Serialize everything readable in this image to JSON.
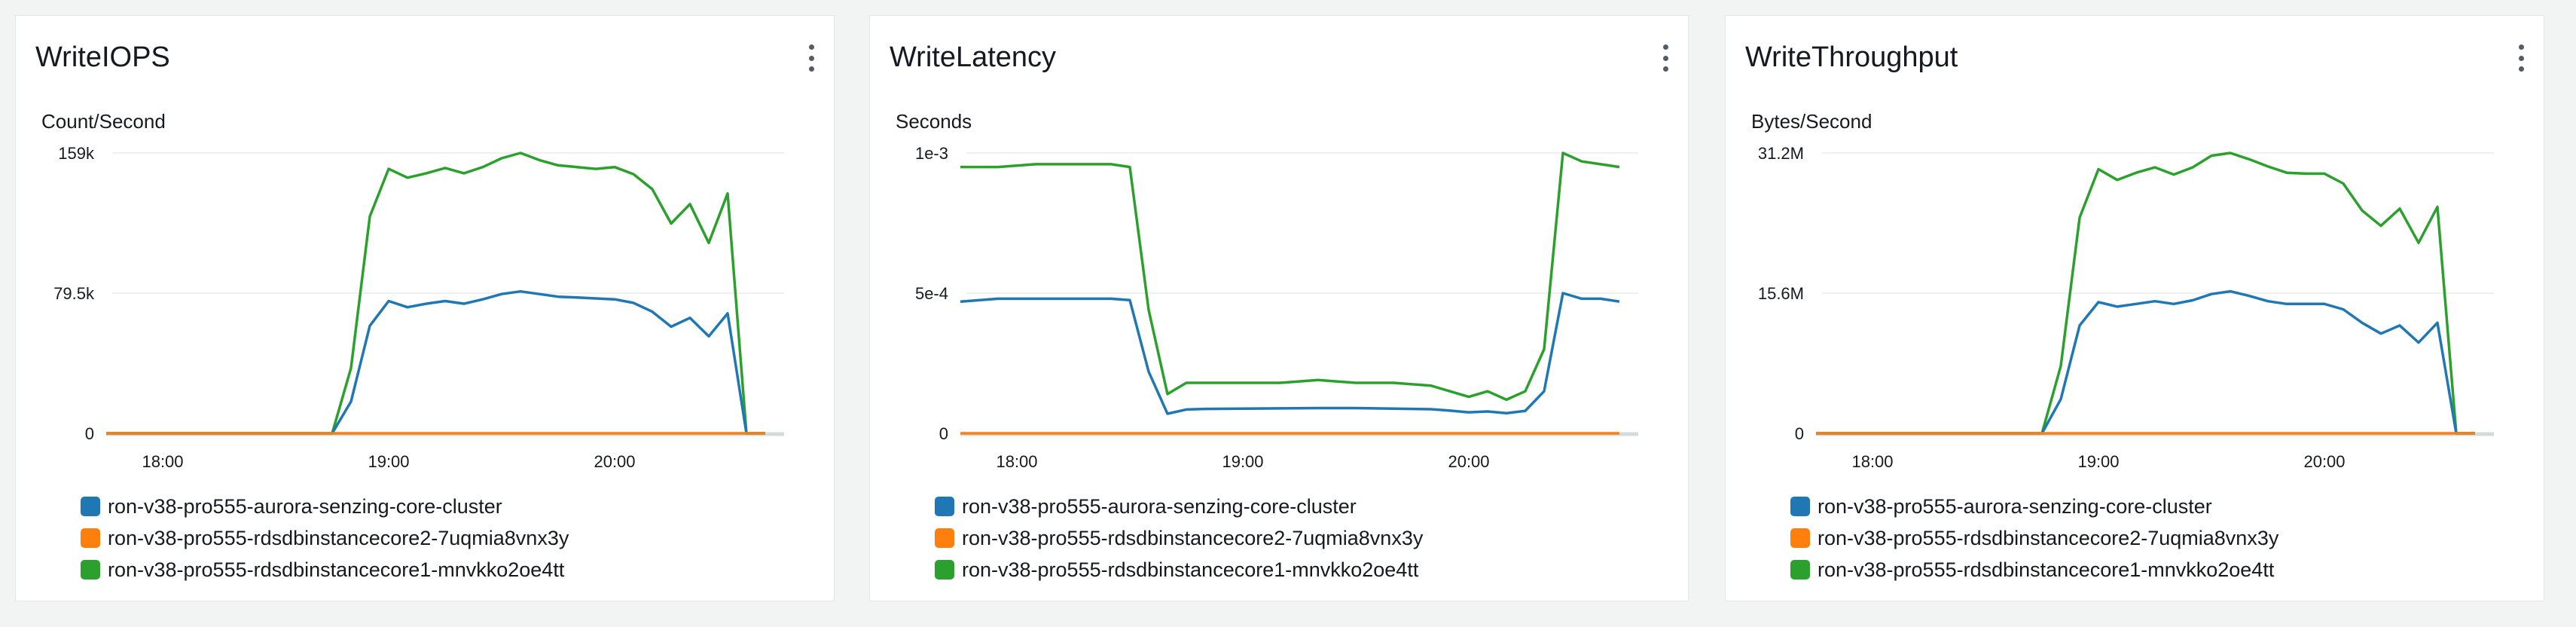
{
  "colors": {
    "blue": "#1f77b4",
    "orange": "#ff7f0e",
    "green": "#2ca02c",
    "grid": "#e9ebed",
    "axis": "#d5dbdb"
  },
  "legend": [
    "ron-v38-pro555-aurora-senzing-core-cluster",
    "ron-v38-pro555-rdsdbinstancecore2-7uqmia8vnx3y",
    "ron-v38-pro555-rdsdbinstancecore1-mnvkko2oe4tt"
  ],
  "widgets": [
    {
      "title": "WriteIOPS",
      "menu_icon": "vertical-ellipsis-icon"
    },
    {
      "title": "WriteLatency",
      "menu_icon": "vertical-ellipsis-icon"
    },
    {
      "title": "WriteThroughput",
      "menu_icon": "vertical-ellipsis-icon"
    }
  ],
  "chart_data": [
    {
      "type": "line",
      "title": "WriteIOPS",
      "ylabel": "Count/Second",
      "ylim": [
        0,
        159000
      ],
      "ytick_values": [
        0,
        79500,
        159000
      ],
      "ytick_labels": [
        "0",
        "79.5k",
        "159k"
      ],
      "xlim": [
        "17:45",
        "20:45"
      ],
      "xticks": [
        "18:00",
        "19:00",
        "20:00"
      ],
      "x": [
        "17:45",
        "17:50",
        "17:55",
        "18:00",
        "18:05",
        "18:10",
        "18:15",
        "18:20",
        "18:25",
        "18:30",
        "18:35",
        "18:40",
        "18:45",
        "18:50",
        "18:55",
        "19:00",
        "19:05",
        "19:10",
        "19:15",
        "19:20",
        "19:25",
        "19:30",
        "19:35",
        "19:40",
        "19:45",
        "19:50",
        "19:55",
        "20:00",
        "20:05",
        "20:10",
        "20:15",
        "20:20",
        "20:25",
        "20:30",
        "20:35",
        "20:40"
      ],
      "series": [
        {
          "name": "ron-v38-pro555-aurora-senzing-core-cluster",
          "color": "#1f77b4",
          "values": [
            0,
            0,
            0,
            0,
            0,
            0,
            0,
            0,
            0,
            0,
            0,
            0,
            0,
            18000,
            61000,
            75000,
            71500,
            73500,
            75000,
            73500,
            76000,
            79000,
            80500,
            79000,
            77500,
            77000,
            76500,
            76000,
            74000,
            69000,
            60500,
            65500,
            55000,
            68000,
            0,
            0
          ]
        },
        {
          "name": "ron-v38-pro555-rdsdbinstancecore2-7uqmia8vnx3y",
          "color": "#ff7f0e",
          "values": [
            0,
            0,
            0,
            0,
            0,
            0,
            0,
            0,
            0,
            0,
            0,
            0,
            0,
            0,
            0,
            0,
            0,
            0,
            0,
            0,
            0,
            0,
            0,
            0,
            0,
            0,
            0,
            0,
            0,
            0,
            0,
            0,
            0,
            0,
            0,
            0
          ]
        },
        {
          "name": "ron-v38-pro555-rdsdbinstancecore1-mnvkko2oe4tt",
          "color": "#2ca02c",
          "values": [
            0,
            0,
            0,
            0,
            0,
            0,
            0,
            0,
            0,
            0,
            0,
            0,
            0,
            37000,
            123000,
            150000,
            145000,
            147500,
            150500,
            147500,
            151000,
            156000,
            159000,
            155000,
            152000,
            151000,
            150000,
            151000,
            147000,
            138500,
            119000,
            130000,
            108000,
            136000,
            0,
            0
          ]
        }
      ]
    },
    {
      "type": "line",
      "title": "WriteLatency",
      "ylabel": "Seconds",
      "ylim": [
        0,
        0.001
      ],
      "ytick_values": [
        0,
        0.0005,
        0.001
      ],
      "ytick_labels": [
        "0",
        "5e-4",
        "1e-3"
      ],
      "xlim": [
        "17:45",
        "20:45"
      ],
      "xticks": [
        "18:00",
        "19:00",
        "20:00"
      ],
      "x": [
        "17:45",
        "17:55",
        "18:05",
        "18:15",
        "18:25",
        "18:30",
        "18:35",
        "18:40",
        "18:45",
        "18:50",
        "19:00",
        "19:10",
        "19:20",
        "19:30",
        "19:40",
        "19:50",
        "19:55",
        "20:00",
        "20:05",
        "20:10",
        "20:15",
        "20:20",
        "20:25",
        "20:30",
        "20:35",
        "20:40"
      ],
      "series": [
        {
          "name": "ron-v38-pro555-aurora-senzing-core-cluster",
          "color": "#1f77b4",
          "values": [
            0.00047,
            0.00048,
            0.00048,
            0.00048,
            0.00048,
            0.000475,
            0.00022,
            7e-05,
            8.5e-05,
            8.7e-05,
            8.8e-05,
            8.9e-05,
            9e-05,
            9e-05,
            8.8e-05,
            8.6e-05,
            8.1e-05,
            7.5e-05,
            7.8e-05,
            7.2e-05,
            8e-05,
            0.00015,
            0.0005,
            0.00048,
            0.00048,
            0.00047
          ]
        },
        {
          "name": "ron-v38-pro555-rdsdbinstancecore2-7uqmia8vnx3y",
          "color": "#ff7f0e",
          "values": [
            0,
            0,
            0,
            0,
            0,
            0,
            0,
            0,
            0,
            0,
            0,
            0,
            0,
            0,
            0,
            0,
            0,
            0,
            0,
            0,
            0,
            0,
            0,
            0,
            0,
            0
          ]
        },
        {
          "name": "ron-v38-pro555-rdsdbinstancecore1-mnvkko2oe4tt",
          "color": "#2ca02c",
          "values": [
            0.00095,
            0.00095,
            0.00096,
            0.00096,
            0.00096,
            0.00095,
            0.00044,
            0.00014,
            0.00018,
            0.00018,
            0.00018,
            0.00018,
            0.00019,
            0.00018,
            0.00018,
            0.00017,
            0.00015,
            0.00013,
            0.00015,
            0.00012,
            0.00015,
            0.0003,
            0.001,
            0.00097,
            0.00096,
            0.00095
          ]
        }
      ]
    },
    {
      "type": "line",
      "title": "WriteThroughput",
      "ylabel": "Bytes/Second",
      "ylim": [
        0,
        31200000
      ],
      "ytick_values": [
        0,
        15600000,
        31200000
      ],
      "ytick_labels": [
        "0",
        "15.6M",
        "31.2M"
      ],
      "xlim": [
        "17:45",
        "20:45"
      ],
      "xticks": [
        "18:00",
        "19:00",
        "20:00"
      ],
      "x": [
        "17:45",
        "17:50",
        "17:55",
        "18:00",
        "18:05",
        "18:10",
        "18:15",
        "18:20",
        "18:25",
        "18:30",
        "18:35",
        "18:40",
        "18:45",
        "18:50",
        "18:55",
        "19:00",
        "19:05",
        "19:10",
        "19:15",
        "19:20",
        "19:25",
        "19:30",
        "19:35",
        "19:40",
        "19:45",
        "19:50",
        "19:55",
        "20:00",
        "20:05",
        "20:10",
        "20:15",
        "20:20",
        "20:25",
        "20:30",
        "20:35",
        "20:40"
      ],
      "series": [
        {
          "name": "ron-v38-pro555-aurora-senzing-core-cluster",
          "color": "#1f77b4",
          "values": [
            0,
            0,
            0,
            0,
            0,
            0,
            0,
            0,
            0,
            0,
            0,
            0,
            0,
            3800000,
            12000000,
            14600000,
            14100000,
            14400000,
            14700000,
            14400000,
            14800000,
            15500000,
            15800000,
            15300000,
            14700000,
            14400000,
            14400000,
            14400000,
            13800000,
            12300000,
            11100000,
            12000000,
            10100000,
            12300000,
            0,
            0
          ]
        },
        {
          "name": "ron-v38-pro555-rdsdbinstancecore2-7uqmia8vnx3y",
          "color": "#ff7f0e",
          "values": [
            0,
            0,
            0,
            0,
            0,
            0,
            0,
            0,
            0,
            0,
            0,
            0,
            0,
            0,
            0,
            0,
            0,
            0,
            0,
            0,
            0,
            0,
            0,
            0,
            0,
            0,
            0,
            0,
            0,
            0,
            0,
            0,
            0,
            0,
            0,
            0
          ]
        },
        {
          "name": "ron-v38-pro555-rdsdbinstancecore1-mnvkko2oe4tt",
          "color": "#2ca02c",
          "values": [
            0,
            0,
            0,
            0,
            0,
            0,
            0,
            0,
            0,
            0,
            0,
            0,
            0,
            7500000,
            24000000,
            29400000,
            28200000,
            29000000,
            29600000,
            28800000,
            29600000,
            30900000,
            31200000,
            30500000,
            29700000,
            29000000,
            28900000,
            28900000,
            27800000,
            24800000,
            23100000,
            25000000,
            21200000,
            25200000,
            0,
            0
          ]
        }
      ]
    }
  ]
}
